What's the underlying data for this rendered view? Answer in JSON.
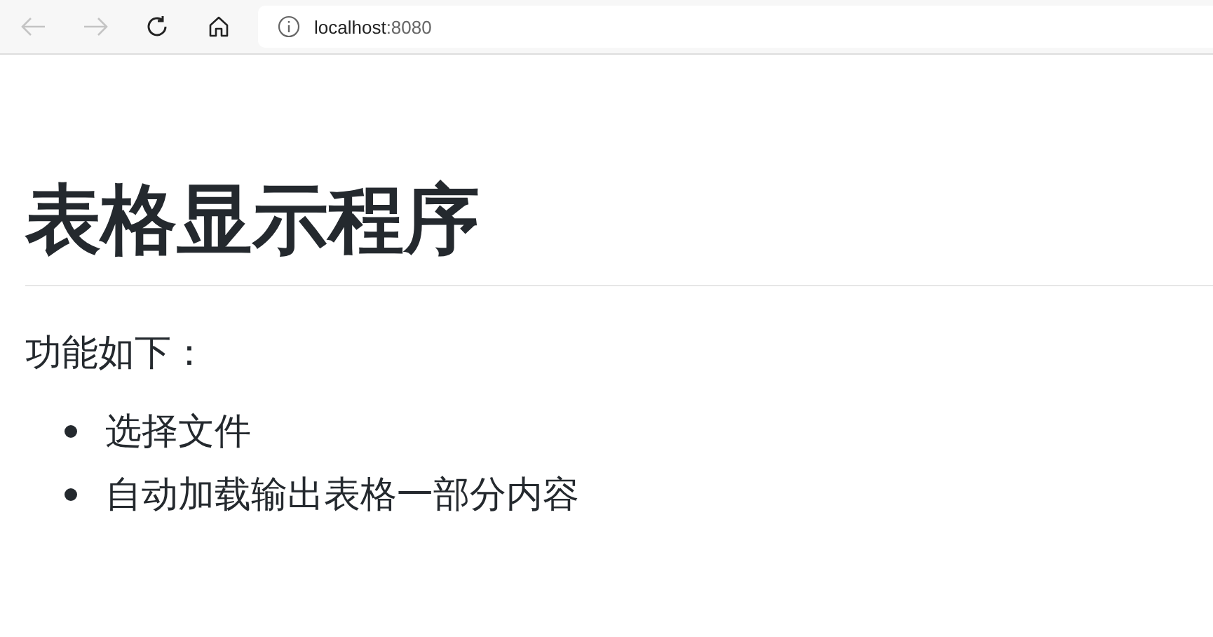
{
  "browser": {
    "back_disabled": true,
    "forward_disabled": true,
    "address_host": "localhost",
    "address_port": ":8080"
  },
  "page": {
    "heading": "表格显示程序",
    "intro": "功能如下：",
    "features": [
      "选择文件",
      "自动加载输出表格一部分内容"
    ]
  }
}
